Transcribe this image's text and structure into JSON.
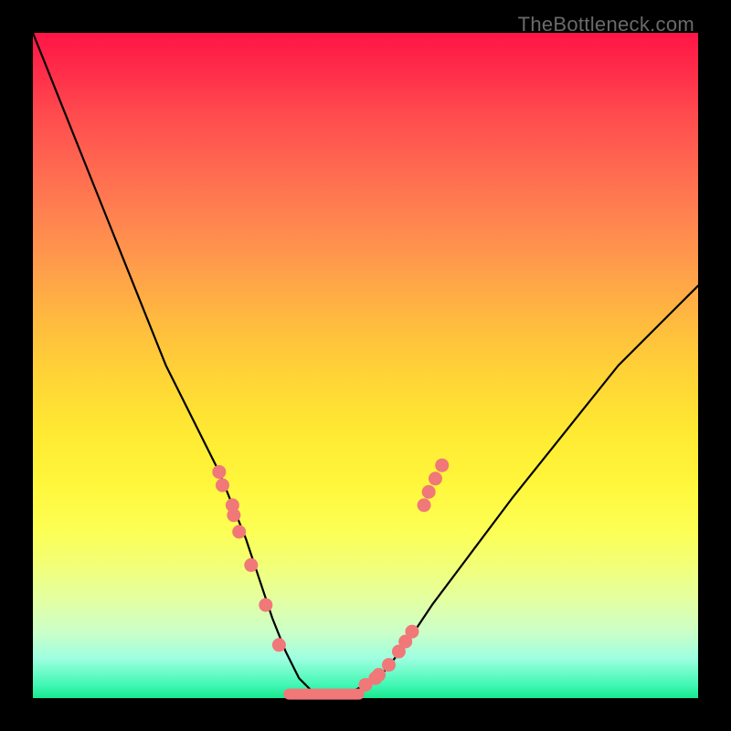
{
  "watermark": "TheBottleneck.com",
  "chart_data": {
    "type": "line",
    "title": "",
    "xlabel": "",
    "ylabel": "",
    "xlim": [
      0,
      100
    ],
    "ylim": [
      0,
      100
    ],
    "curve": {
      "name": "bottleneck-curve",
      "x": [
        0,
        4,
        8,
        12,
        16,
        20,
        24,
        28,
        30,
        32,
        34,
        36,
        38,
        40,
        42,
        44,
        46,
        48,
        52,
        56,
        60,
        66,
        72,
        80,
        88,
        96,
        100
      ],
      "y": [
        100,
        90,
        80,
        70,
        60,
        50,
        42,
        34,
        29,
        24,
        18,
        12,
        7,
        3,
        1,
        0.5,
        0.5,
        1,
        3,
        8,
        14,
        22,
        30,
        40,
        50,
        58,
        62
      ]
    },
    "markers_left": {
      "name": "left-cluster",
      "color": "#f07878",
      "x": [
        28.0,
        28.5,
        30.0,
        30.2,
        31.0,
        32.8,
        35.0,
        37.0
      ],
      "y": [
        34.0,
        32.0,
        29.0,
        27.5,
        25.0,
        20.0,
        14.0,
        8.0
      ]
    },
    "markers_right": {
      "name": "right-cluster",
      "color": "#f07878",
      "x": [
        50.0,
        51.5,
        52.0,
        53.5,
        55.0,
        56.0,
        57.0,
        58.8,
        59.5,
        60.5,
        61.5
      ],
      "y": [
        2.0,
        3.0,
        3.5,
        5.0,
        7.0,
        8.5,
        10.0,
        29.0,
        31.0,
        33.0,
        35.0
      ]
    },
    "flat_segment": {
      "name": "bottom-flat",
      "color": "#f07878",
      "x0": 38.5,
      "x1": 49.0,
      "y": 0.6,
      "thickness": 12
    }
  }
}
